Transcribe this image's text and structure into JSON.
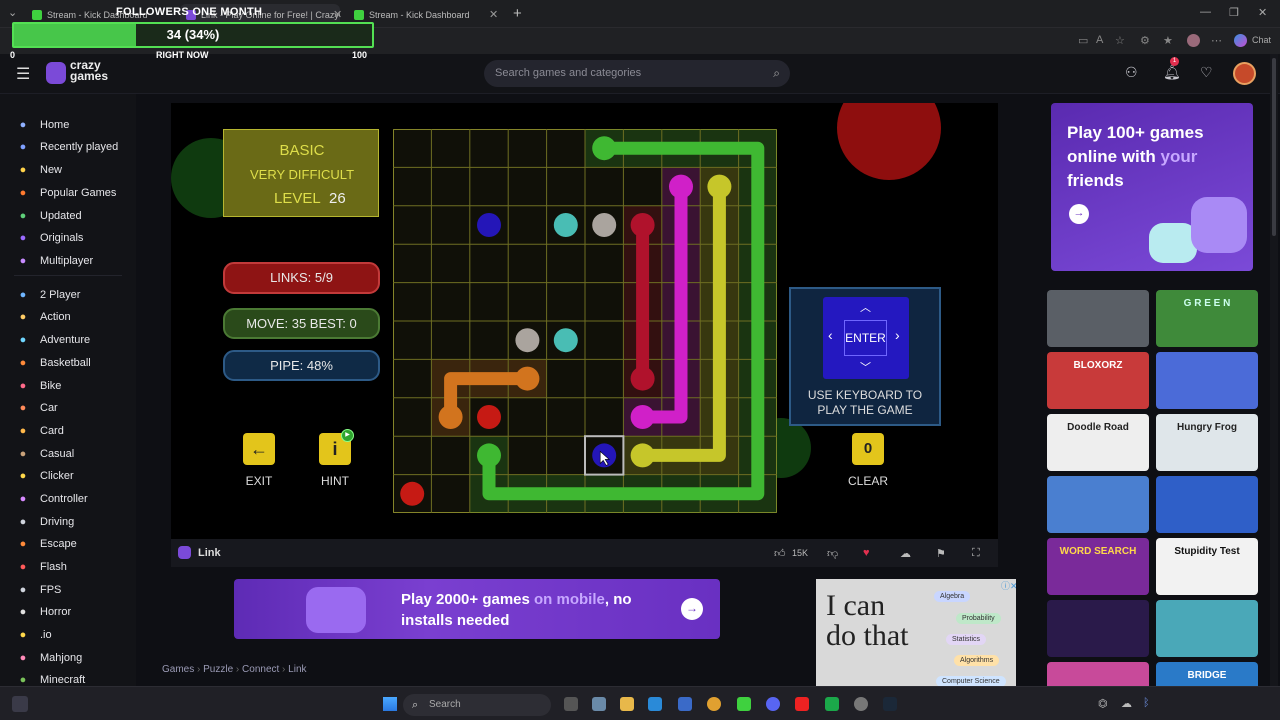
{
  "browser": {
    "tabs": [
      {
        "label": "Stream - Kick Dashboard"
      },
      {
        "label": "Link - Play Online for Free! | CrazyGames"
      },
      {
        "label": "Stream - Kick Dashboard"
      }
    ],
    "chat_label": "Chat"
  },
  "overlay": {
    "title": "FOLLOWERS ONE MONTH",
    "value_text": "34 (34%)",
    "progress": 0.34,
    "min_label": "0",
    "now_label": "RIGHT NOW",
    "max_label": "100"
  },
  "header": {
    "logo_line1": "crazy",
    "logo_line2": "games",
    "search_placeholder": "Search games and categories",
    "notification_count": "1"
  },
  "sidebar": {
    "items": [
      {
        "label": "Home",
        "icon": "home-icon",
        "color": "#8fb0ff"
      },
      {
        "label": "Recently played",
        "icon": "clock-icon",
        "color": "#7fa0ff"
      },
      {
        "label": "New",
        "icon": "sparkle-icon",
        "color": "#ffd24a"
      },
      {
        "label": "Popular Games",
        "icon": "flame-icon",
        "color": "#ff7a2f"
      },
      {
        "label": "Updated",
        "icon": "refresh-icon",
        "color": "#5fd07a"
      },
      {
        "label": "Originals",
        "icon": "crazygames-icon",
        "color": "#9b6bff"
      },
      {
        "label": "Multiplayer",
        "icon": "people-icon",
        "color": "#c78bff"
      },
      {
        "label": "2 Player",
        "icon": "two-people-icon",
        "color": "#6fb6ff"
      },
      {
        "label": "Action",
        "icon": "sword-icon",
        "color": "#ffcc66"
      },
      {
        "label": "Adventure",
        "icon": "compass-icon",
        "color": "#6fd6ff"
      },
      {
        "label": "Basketball",
        "icon": "basketball-icon",
        "color": "#ff8a3a"
      },
      {
        "label": "Bike",
        "icon": "bike-icon",
        "color": "#ff6a8a"
      },
      {
        "label": "Car",
        "icon": "car-icon",
        "color": "#ff8a5a"
      },
      {
        "label": "Card",
        "icon": "card-icon",
        "color": "#ffb84a"
      },
      {
        "label": "Casual",
        "icon": "casual-icon",
        "color": "#c9a27a"
      },
      {
        "label": "Clicker",
        "icon": "cursor-icon",
        "color": "#ffd84a"
      },
      {
        "label": "Controller",
        "icon": "gamepad-icon",
        "color": "#d78aff"
      },
      {
        "label": "Driving",
        "icon": "steering-icon",
        "color": "#cfd4dd"
      },
      {
        "label": "Escape",
        "icon": "door-icon",
        "color": "#ff8a3a"
      },
      {
        "label": "Flash",
        "icon": "flash-icon",
        "color": "#ff5a5a"
      },
      {
        "label": "FPS",
        "icon": "gun-icon",
        "color": "#cfd4dd"
      },
      {
        "label": "Horror",
        "icon": "ghost-icon",
        "color": "#e0e0e0"
      },
      {
        "label": ".io",
        "icon": "io-icon",
        "color": "#ffd84a"
      },
      {
        "label": "Mahjong",
        "icon": "mahjong-icon",
        "color": "#ff8ab8"
      },
      {
        "label": "Minecraft",
        "icon": "minecraft-icon",
        "color": "#7ac25a"
      }
    ]
  },
  "game": {
    "mode": "BASIC",
    "difficulty": "VERY DIFFICULT",
    "level_label": "LEVEL",
    "level_value": "26",
    "links": "LINKS:   5/9",
    "moves": "MOVE: 35   BEST: 0",
    "pipe": "PIPE:   48%",
    "exit_label": "EXIT",
    "hint_label": "HINT",
    "clear_label": "CLEAR",
    "clear_count": "0",
    "enter_label": "ENTER",
    "keyboard_hint_1": "USE KEYBOARD TO",
    "keyboard_hint_2": "PLAY THE GAME",
    "grid_size": 10,
    "colors": {
      "green": "#3fb832",
      "magenta": "#d020c8",
      "yellow": "#c6c62a",
      "red": "#b0122c",
      "orange": "#d2741e",
      "cyan": "#49bdb4",
      "grey": "#aaa49e",
      "blue": "#2416b8",
      "bright_red": "#c61a14"
    }
  },
  "game_bar": {
    "title": "Link",
    "likes": "15K"
  },
  "promo": {
    "text_a": "Play 2000+ games ",
    "text_b": "on mobile",
    "text_c": ", no installs needed"
  },
  "ad": {
    "headline_1": "I can",
    "headline_2": "do that",
    "pills": [
      "Algebra",
      "Probability",
      "Statistics",
      "Algorithms",
      "Computer Science"
    ]
  },
  "breadcrumb": [
    "Games",
    "Puzzle",
    "Connect",
    "Link"
  ],
  "right_promo": {
    "line1": "Play 100+ games",
    "line2": "online with ",
    "line2_hl": "your",
    "line3": "friends"
  },
  "thumbnails": [
    {
      "label": "",
      "name": "lightbulb-plug-thumb"
    },
    {
      "label": "G R E E N",
      "name": "green-thumb"
    },
    {
      "label": "BLOXORZ",
      "name": "bloxorz-thumb"
    },
    {
      "label": "",
      "name": "runner-thumb"
    },
    {
      "label": "Doodle Road",
      "name": "doodle-road-thumb"
    },
    {
      "label": "Hungry Frog",
      "name": "hungry-frog-thumb"
    },
    {
      "label": "",
      "name": "tic-tac-thumb"
    },
    {
      "label": "",
      "name": "pattern-thumb"
    },
    {
      "label": "WORD SEARCH",
      "name": "word-search-thumb"
    },
    {
      "label": "Stupidity Test",
      "name": "stupidity-test-thumb"
    },
    {
      "label": "",
      "name": "neon-thumb"
    },
    {
      "label": "",
      "name": "ropes-thumb"
    },
    {
      "label": "",
      "name": "candy-thumb"
    },
    {
      "label": "BRIDGE",
      "name": "bridge-thumb"
    }
  ],
  "taskbar": {
    "search_placeholder": "Search"
  }
}
